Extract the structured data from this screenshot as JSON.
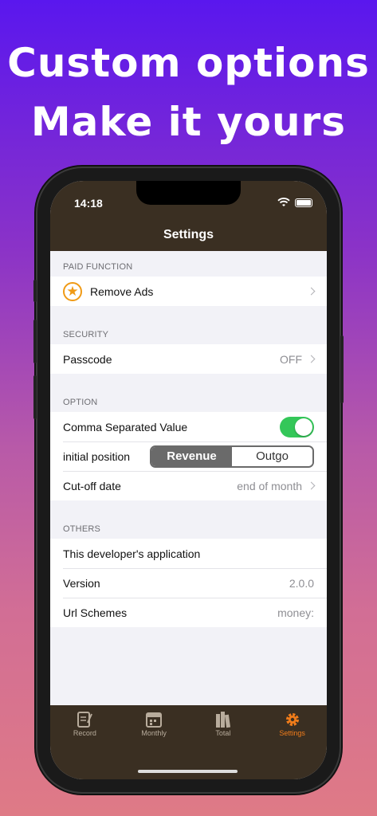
{
  "promo": {
    "line1": "Custom options",
    "line2": "Make it yours"
  },
  "status_bar": {
    "time": "14:18"
  },
  "nav": {
    "title": "Settings"
  },
  "sections": {
    "paid": {
      "header": "PAID FUNCTION",
      "remove_ads": "Remove Ads"
    },
    "security": {
      "header": "SECURITY",
      "passcode_label": "Passcode",
      "passcode_value": "OFF"
    },
    "option": {
      "header": "OPTION",
      "csv_label": "Comma Separated Value",
      "csv_enabled": true,
      "initial_position_label": "initial position",
      "segments": [
        "Revenue",
        "Outgo"
      ],
      "selected_segment": "Revenue",
      "cutoff_label": "Cut-off date",
      "cutoff_value": "end of month"
    },
    "others": {
      "header": "OTHERS",
      "developer_apps": "This developer's application",
      "version_label": "Version",
      "version_value": "2.0.0",
      "url_label": "Url Schemes",
      "url_value": "money:"
    }
  },
  "tabbar": {
    "tabs": [
      {
        "label": "Record",
        "icon": "record-icon"
      },
      {
        "label": "Monthly",
        "icon": "calendar-icon"
      },
      {
        "label": "Total",
        "icon": "books-icon"
      },
      {
        "label": "Settings",
        "icon": "gear-icon"
      }
    ],
    "active": "Settings"
  },
  "colors": {
    "accent": "#f07c1a",
    "bar": "#3a2f22",
    "toggle_on": "#34c759",
    "star": "#f09a15"
  }
}
